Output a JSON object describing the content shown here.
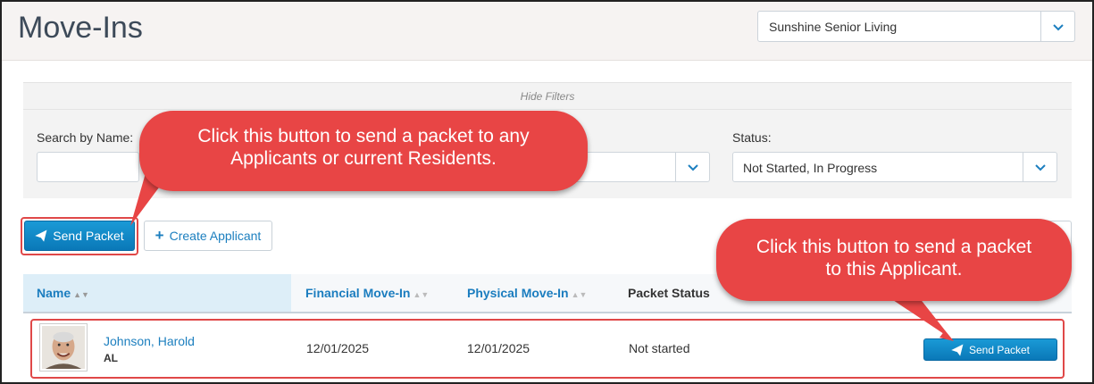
{
  "page": {
    "title": "Move-Ins"
  },
  "community_select": {
    "value": "Sunshine Senior Living"
  },
  "filters": {
    "toggle_label": "Hide Filters",
    "search_label": "Search by Name:",
    "search_value": "",
    "status_label": "Status:",
    "status_value": "Not Started, In Progress"
  },
  "toolbar": {
    "send_packet_label": "Send Packet",
    "create_applicant_label": "Create Applicant"
  },
  "table": {
    "columns": [
      "Name",
      "Financial Move-In",
      "Physical Move-In",
      "Packet Status"
    ],
    "rows": [
      {
        "name": "Johnson, Harold",
        "care_level": "AL",
        "financial_move_in": "12/01/2025",
        "physical_move_in": "12/01/2025",
        "packet_status": "Not started",
        "action_label": "Send Packet"
      }
    ]
  },
  "callouts": {
    "toolbar": "Click this button to send a packet to any Applicants or current Residents.",
    "row": "Click this button to send a packet to this Applicant."
  },
  "colors": {
    "accent": "#1c7fbf",
    "primary_button": "#0f86c6",
    "callout": "#e84545"
  },
  "icons": {
    "send": "paper-plane-icon",
    "add": "plus-icon",
    "dropdown": "chevron-down-icon"
  }
}
